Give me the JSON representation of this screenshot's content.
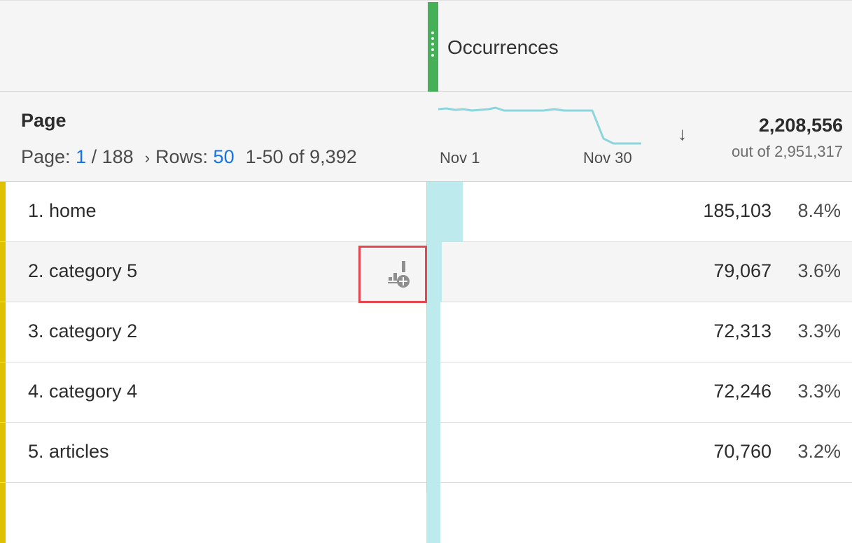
{
  "metric": {
    "title": "Occurrences",
    "handle_color": "#45b058"
  },
  "dimension": {
    "title": "Page",
    "pager": {
      "page_label": "Page:",
      "page_current": "1",
      "page_total": "/ 188",
      "next_icon": "chevron-right-icon",
      "rows_label": "Rows:",
      "rows_value": "50",
      "range": "1-50 of 9,392"
    }
  },
  "sparkline": {
    "start_label": "Nov 1",
    "end_label": "Nov 30",
    "color": "#8ad6dc"
  },
  "sort": {
    "icon": "arrow-down-icon"
  },
  "totals": {
    "value": "2,208,556",
    "out_of": "out of 2,951,317"
  },
  "rows": [
    {
      "label": "1. home",
      "value": "185,103",
      "pct": "8.4%",
      "share": 0.084
    },
    {
      "label": "2. category 5",
      "value": "79,067",
      "pct": "3.6%",
      "share": 0.036
    },
    {
      "label": "3. category 2",
      "value": "72,313",
      "pct": "3.3%",
      "share": 0.033
    },
    {
      "label": "4. category 4",
      "value": "72,246",
      "pct": "3.3%",
      "share": 0.033
    },
    {
      "label": "5. articles",
      "value": "70,760",
      "pct": "3.2%",
      "share": 0.032
    }
  ],
  "breakdown": {
    "icon": "breakdown-add-icon",
    "highlight_color": "#e34850"
  },
  "colors": {
    "accent": "#e0c100",
    "bar": "#bdeaed",
    "link": "#1473e6"
  }
}
